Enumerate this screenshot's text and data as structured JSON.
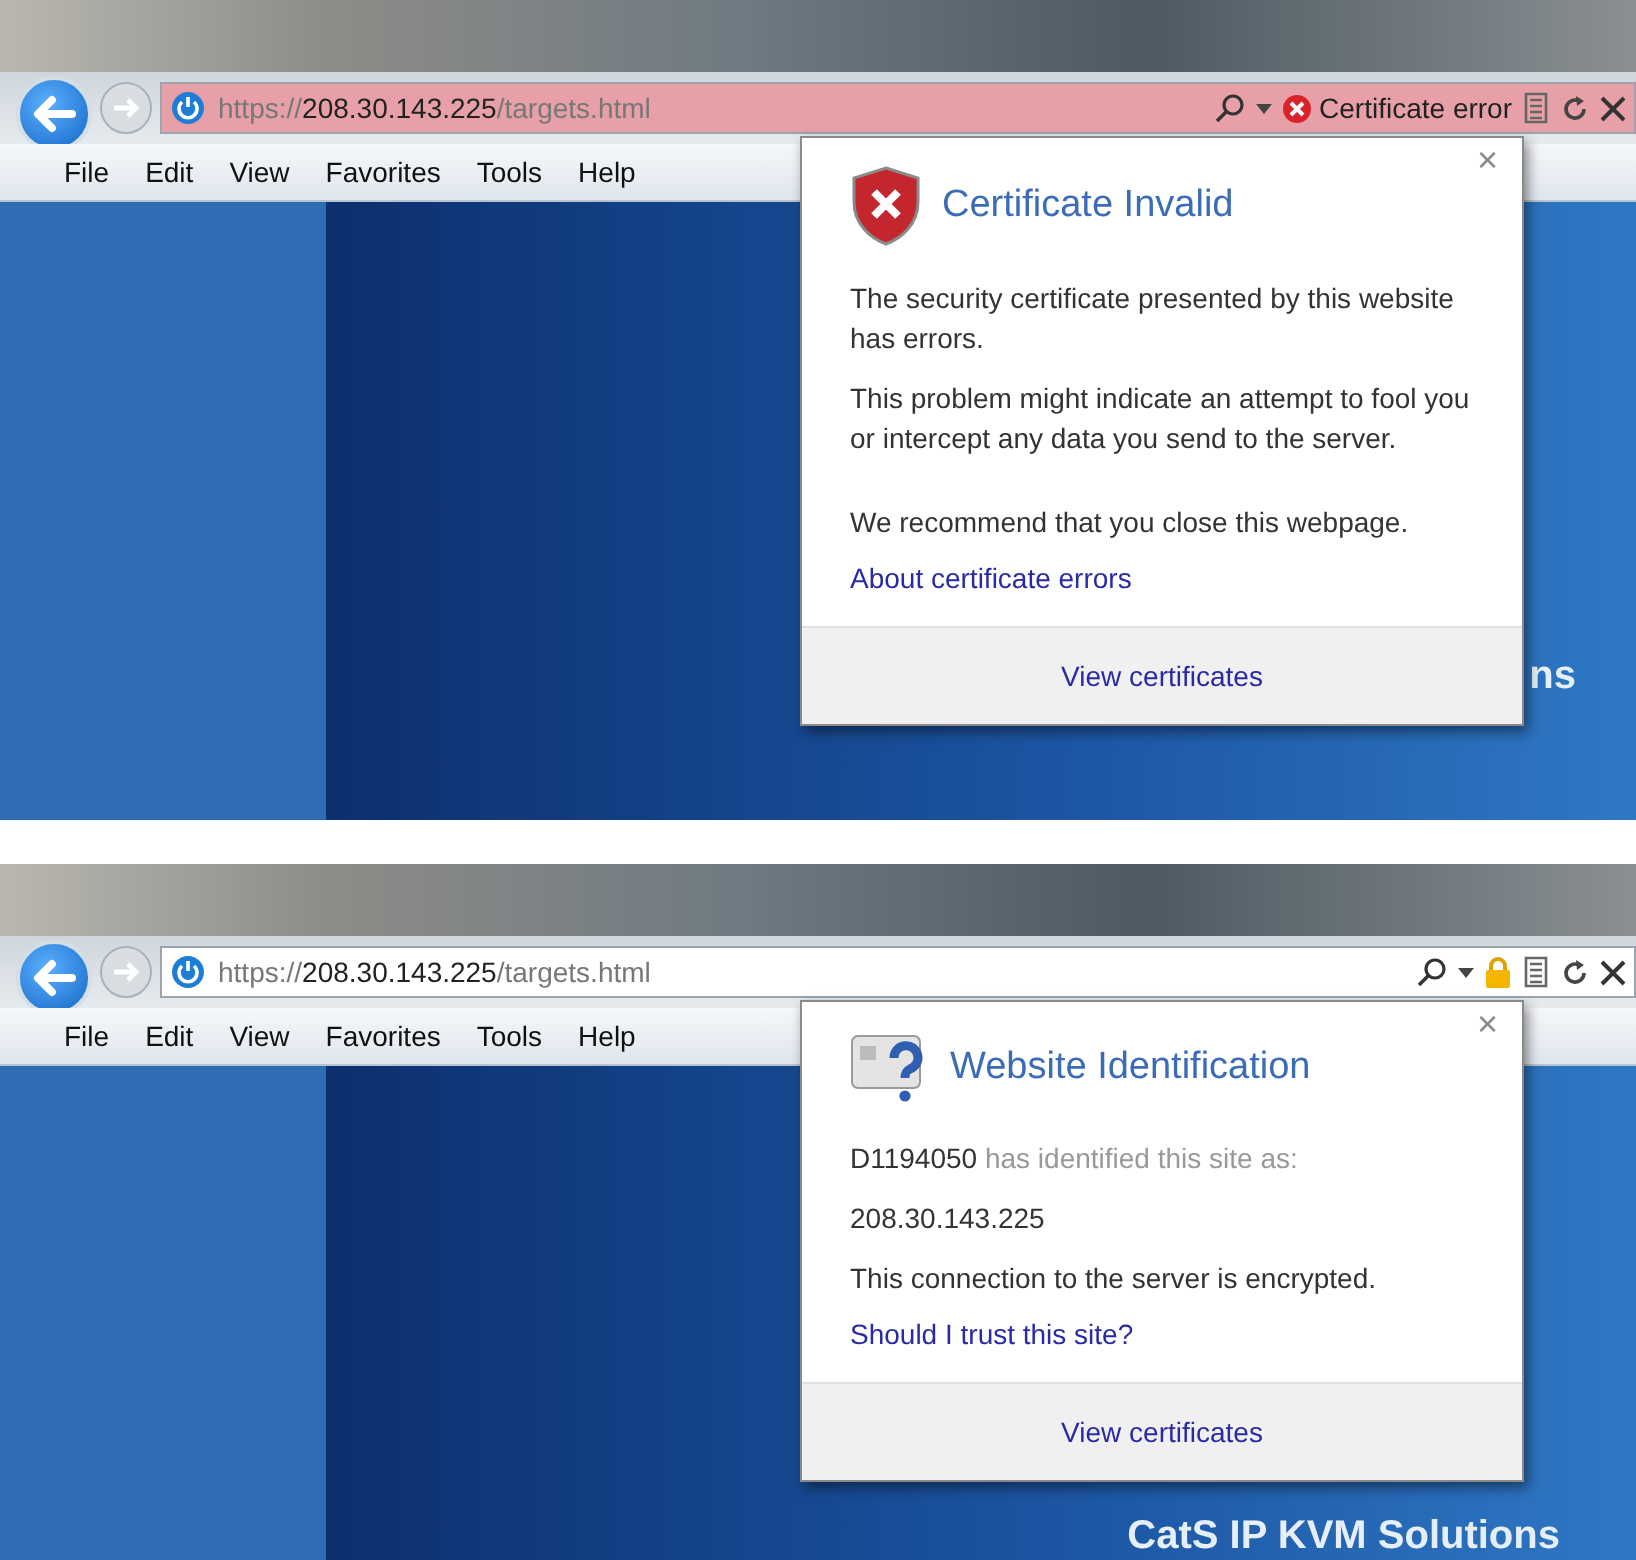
{
  "shots": [
    {
      "address": {
        "scheme": "https://",
        "host": "208.30.143.225",
        "path": "/targets.html"
      },
      "security": {
        "kind": "error",
        "label": "Certificate error"
      },
      "menu": [
        "File",
        "Edit",
        "View",
        "Favorites",
        "Tools",
        "Help"
      ],
      "page_text": "ns",
      "popup": {
        "kind": "certificate",
        "title": "Certificate Invalid",
        "paragraphs": [
          "The security certificate presented by this website has errors.",
          "This problem might indicate an attempt to fool you or intercept any data you send to the server.",
          "We recommend that you close this webpage."
        ],
        "link": "About certificate errors",
        "close": "×",
        "footer_button": "View certificates"
      }
    },
    {
      "address": {
        "scheme": "https://",
        "host": "208.30.143.225",
        "path": "/targets.html"
      },
      "security": {
        "kind": "lock"
      },
      "menu": [
        "File",
        "Edit",
        "View",
        "Favorites",
        "Tools",
        "Help"
      ],
      "page_text": "CatS IP KVM Solutions",
      "popup": {
        "kind": "identification",
        "title": "Website Identification",
        "identifier": "D1194050",
        "identified_text": "has identified this site as:",
        "site": "208.30.143.225",
        "note": "This connection to the server is encrypted.",
        "link": "Should I trust this site?",
        "close": "×",
        "footer_button": "View certificates"
      }
    }
  ]
}
